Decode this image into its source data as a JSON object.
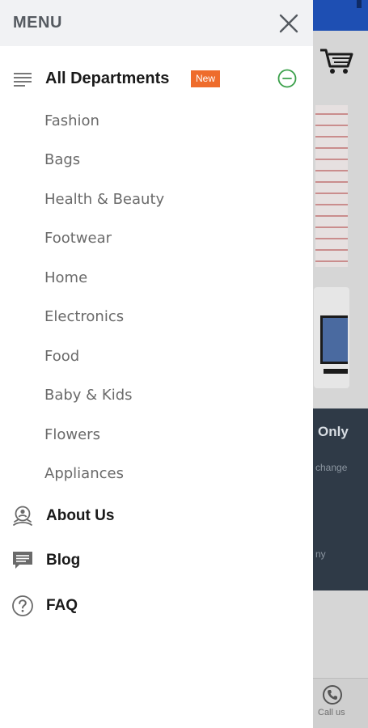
{
  "menu": {
    "title": "MENU",
    "departments": {
      "label": "All Departments",
      "badge": "New",
      "items": [
        "Fashion",
        "Bags",
        "Health & Beauty",
        "Footwear",
        "Home",
        "Electronics",
        "Food",
        "Baby & Kids",
        "Flowers",
        "Appliances"
      ]
    },
    "about_label": "About Us",
    "blog_label": "Blog",
    "faq_label": "FAQ"
  },
  "background": {
    "promo_text": "Only",
    "promo_sub": "change",
    "promo_sub2": "ny",
    "call_label": "Call us"
  },
  "colors": {
    "header_bg": "#f1f2f4",
    "badge_bg": "#ee6c2c",
    "collapse_green": "#3aa04a",
    "topbar_blue": "#1e4fb3"
  },
  "icons": {
    "close": "close-icon",
    "list": "list-icon",
    "collapse": "minus-circle-icon",
    "about": "award-icon",
    "blog": "chat-icon",
    "faq": "question-circle-icon",
    "cart": "cart-icon",
    "call": "phone-icon"
  }
}
